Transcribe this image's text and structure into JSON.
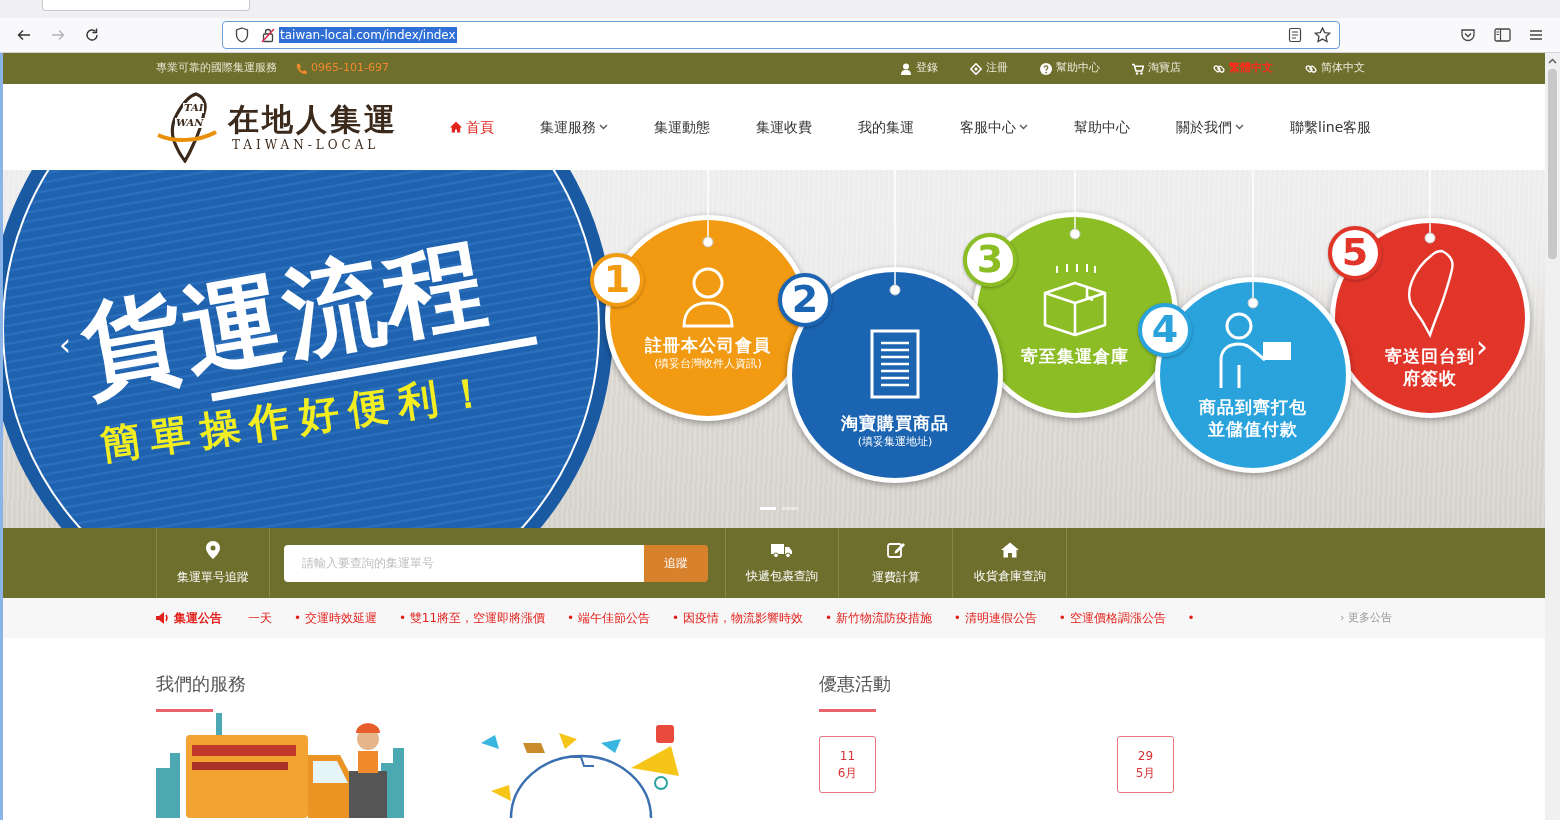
{
  "browser": {
    "address": {
      "url": "taiwan-local.com/index/index",
      "selected": true
    },
    "forward_disabled": true
  },
  "top_bar": {
    "tagline": "專業可靠的國際集運服務",
    "phone": "0965-101-697",
    "links": [
      {
        "label": "登錄"
      },
      {
        "label": "注冊"
      },
      {
        "label": "幫助中心"
      },
      {
        "label": "淘寶店"
      }
    ],
    "languages": [
      {
        "label": "繁體中文",
        "selected": true
      },
      {
        "label": "简体中文",
        "selected": false
      }
    ]
  },
  "header": {
    "logo": {
      "emblem_lines": [
        "TAI",
        "WAN"
      ],
      "name": "在地人集運",
      "subtitle": "TAIWAN-LOCAL"
    },
    "menu": [
      {
        "label": "首頁",
        "selected": true,
        "dropdown": false
      },
      {
        "label": "集運服務",
        "selected": false,
        "dropdown": true
      },
      {
        "label": "集運動態",
        "selected": false,
        "dropdown": false
      },
      {
        "label": "集運收費",
        "selected": false,
        "dropdown": false
      },
      {
        "label": "我的集運",
        "selected": false,
        "dropdown": false
      },
      {
        "label": "客服中心",
        "selected": false,
        "dropdown": true
      },
      {
        "label": "幫助中心",
        "selected": false,
        "dropdown": false
      },
      {
        "label": "關於我們",
        "selected": false,
        "dropdown": true
      },
      {
        "label": "聯繫line客服",
        "selected": false,
        "dropdown": false
      }
    ]
  },
  "banner": {
    "prev": "‹",
    "next": "›",
    "title": "貨運流程",
    "slogan": "簡單操作好便利！",
    "steps": [
      {
        "number": "1",
        "lines": [
          "註冊本公司會員"
        ],
        "note": "(填妥台灣收件人資訊)",
        "color": "#f29a12"
      },
      {
        "number": "2",
        "lines": [
          "淘寶購買商品"
        ],
        "note": "(填妥集運地址)",
        "color": "#1b64b2"
      },
      {
        "number": "3",
        "lines": [
          "寄至集運倉庫"
        ],
        "color": "#8cbd25"
      },
      {
        "number": "4",
        "lines": [
          "商品到齊打包",
          "並儲值付款"
        ],
        "color": "#2aa3dd"
      },
      {
        "number": "5",
        "lines": [
          "寄送回台到",
          "府簽收"
        ],
        "color": "#e2352a"
      }
    ],
    "indicators": [
      {
        "selected": true
      },
      {
        "selected": false
      }
    ]
  },
  "tracking_bar": {
    "label": "集運單号追蹤",
    "search": {
      "placeholder": "請輸入要查詢的集運單号",
      "button": "追蹤"
    },
    "tools": [
      {
        "label": "快遞包裹查詢"
      },
      {
        "label": "運費計算"
      },
      {
        "label": "收貨倉庫查詢"
      }
    ]
  },
  "notice_bar": {
    "title": "集運公告",
    "items": [
      "一天",
      "• 交運時效延遲",
      "• 雙11將至，空運即將漲價",
      "• 端午佳節公告",
      "• 因疫情，物流影響時效",
      "• 新竹物流防疫措施",
      "• 清明連假公告",
      "• 空運價格調漲公告"
    ],
    "end_mark": "•",
    "more": "› 更多公告"
  },
  "services": {
    "title": "我們的服務"
  },
  "promotions": {
    "title": "優惠活動",
    "items": [
      {
        "day": "11",
        "month": "6月"
      },
      {
        "day": "29",
        "month": "5月"
      }
    ]
  }
}
